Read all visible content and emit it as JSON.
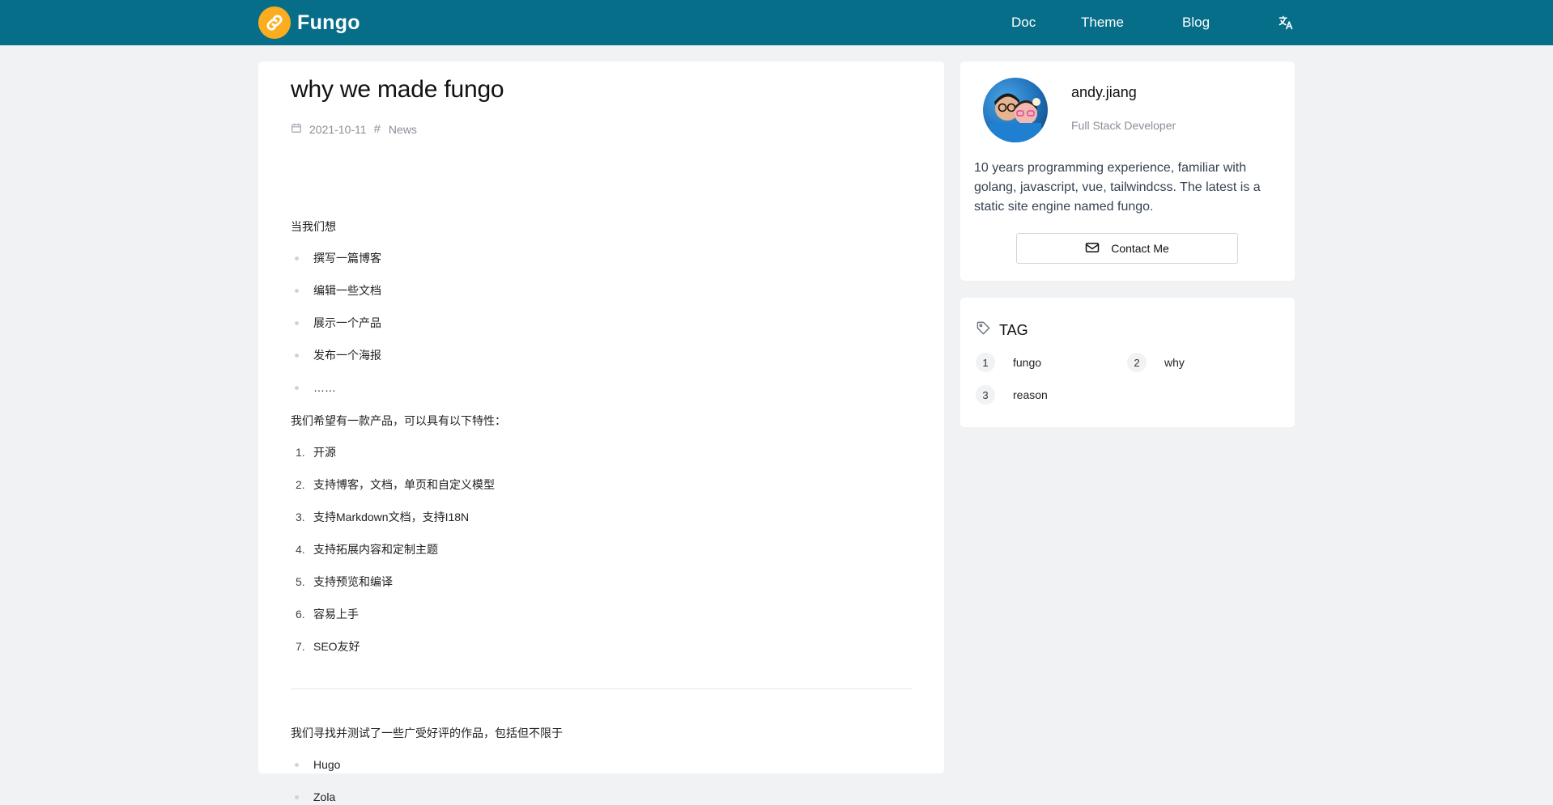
{
  "header": {
    "brand": "Fungo",
    "nav": {
      "doc": "Doc",
      "theme": "Theme",
      "blog": "Blog"
    },
    "icons": {
      "logo": "link-icon",
      "language": "translate-icon"
    },
    "colors": {
      "bar": "#076e8a",
      "logo": "#fbad1e"
    }
  },
  "article": {
    "title": "why we made fungo",
    "date": "2021-10-11",
    "category": "News",
    "intro": "当我们想",
    "wants": [
      "撰写一篇博客",
      "编辑一些文档",
      "展示一个产品",
      "发布一个海报",
      "……"
    ],
    "features_intro": "我们希望有一款产品，可以具有以下特性：",
    "features": [
      "开源",
      "支持博客，文档，单页和自定义模型",
      "支持Markdown文档，支持I18N",
      "支持拓展内容和定制主题",
      "支持预览和编译",
      "容易上手",
      "SEO友好"
    ],
    "search_intro": "我们寻找并测试了一些广受好评的作品，包括但不限于",
    "products": [
      "Hugo",
      "Zola"
    ]
  },
  "profile": {
    "name": "andy.jiang",
    "role": "Full Stack Developer",
    "bio": "10 years programming experience, familiar with golang, javascript, vue, tailwindcss. The latest is a static site engine named fungo.",
    "contact_label": "Contact Me"
  },
  "tags": {
    "title": "TAG",
    "items": [
      {
        "count": "1",
        "name": "fungo"
      },
      {
        "count": "2",
        "name": "why"
      },
      {
        "count": "3",
        "name": "reason"
      }
    ]
  }
}
